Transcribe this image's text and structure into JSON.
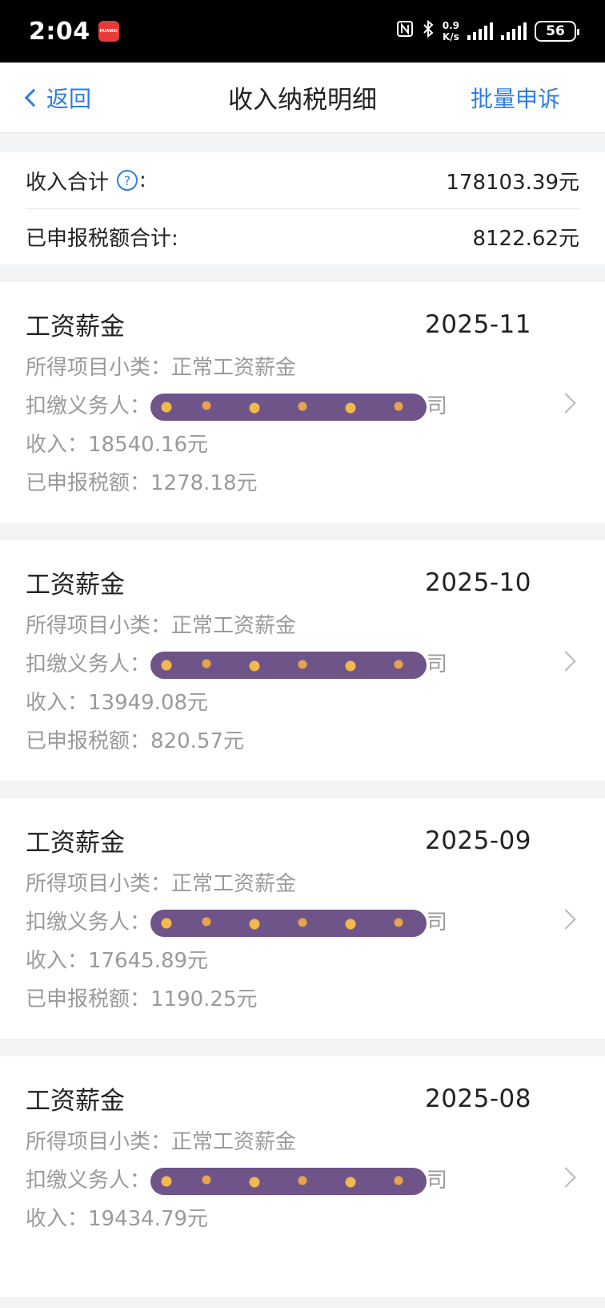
{
  "status_bar": {
    "time": "2:04",
    "app_badge": "HUAWEI",
    "net_speed_value": "0.9",
    "net_speed_unit": "K/s",
    "battery": "56"
  },
  "nav": {
    "back_label": "返回",
    "title": "收入纳税明细",
    "action_label": "批量申诉"
  },
  "summary": {
    "income_label": "收入合计",
    "income_colon": ":",
    "income_value": "178103.39元",
    "tax_label": "已申报税额合计:",
    "tax_value": "8122.62元"
  },
  "records": [
    {
      "type": "工资薪金",
      "period": "2025-11",
      "subcategory": "所得项目小类：正常工资薪金",
      "withholder_label": "扣缴义务人：",
      "withholder_suffix": "司",
      "income": "收入：18540.16元",
      "tax": "已申报税额：1278.18元"
    },
    {
      "type": "工资薪金",
      "period": "2025-10",
      "subcategory": "所得项目小类：正常工资薪金",
      "withholder_label": "扣缴义务人：",
      "withholder_suffix": "司",
      "income": "收入：13949.08元",
      "tax": "已申报税额：820.57元"
    },
    {
      "type": "工资薪金",
      "period": "2025-09",
      "subcategory": "所得项目小类：正常工资薪金",
      "withholder_label": "扣缴义务人：",
      "withholder_suffix": "司",
      "income": "收入：17645.89元",
      "tax": "已申报税额：1190.25元"
    },
    {
      "type": "工资薪金",
      "period": "2025-08",
      "subcategory": "所得项目小类：正常工资薪金",
      "withholder_label": "扣缴义务人：",
      "withholder_suffix": "司",
      "income": "收入：19434.79元",
      "tax": ""
    }
  ]
}
